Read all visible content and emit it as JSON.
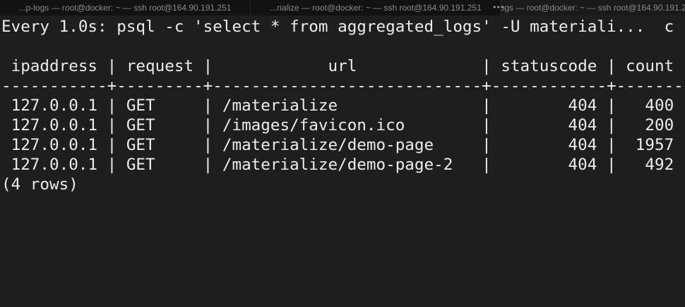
{
  "tabs": [
    {
      "title": "...p-logs — root@docker: ~ — ssh root@164.90.191.251"
    },
    {
      "title": "...rialize — root@docker: ~ — ssh root@164.90.191.251"
    },
    {
      "title": "...logs — root@docker: ~ — ssh root@164.90.191.251"
    }
  ],
  "tab_more_glyph": "•••",
  "terminal": {
    "watch_header": "Every 1.0s: psql -c 'select * from aggregated_logs' -U materiali...  c",
    "table": {
      "header": " ipaddress | request |            url             | statuscode | count",
      "separator": "-----------+---------+----------------------------+------------+-------",
      "rows": [
        " 127.0.0.1 | GET     | /materialize               |        404 |   400",
        " 127.0.0.1 | GET     | /images/favicon.ico        |        404 |   200",
        " 127.0.0.1 | GET     | /materialize/demo-page     |        404 |  1957",
        " 127.0.0.1 | GET     | /materialize/demo-page-2   |        404 |   492"
      ],
      "columns": [
        "ipaddress",
        "request",
        "url",
        "statuscode",
        "count"
      ],
      "records": [
        {
          "ipaddress": "127.0.0.1",
          "request": "GET",
          "url": "/materialize",
          "statuscode": 404,
          "count": 400
        },
        {
          "ipaddress": "127.0.0.1",
          "request": "GET",
          "url": "/images/favicon.ico",
          "statuscode": 404,
          "count": 200
        },
        {
          "ipaddress": "127.0.0.1",
          "request": "GET",
          "url": "/materialize/demo-page",
          "statuscode": 404,
          "count": 1957
        },
        {
          "ipaddress": "127.0.0.1",
          "request": "GET",
          "url": "/materialize/demo-page-2",
          "statuscode": 404,
          "count": 492
        }
      ]
    },
    "footer": "(4 rows)"
  },
  "colors": {
    "background": "#1e1e1e",
    "text": "#ececec",
    "tabbar": "#121212",
    "tab_text": "#8a8a8a"
  }
}
